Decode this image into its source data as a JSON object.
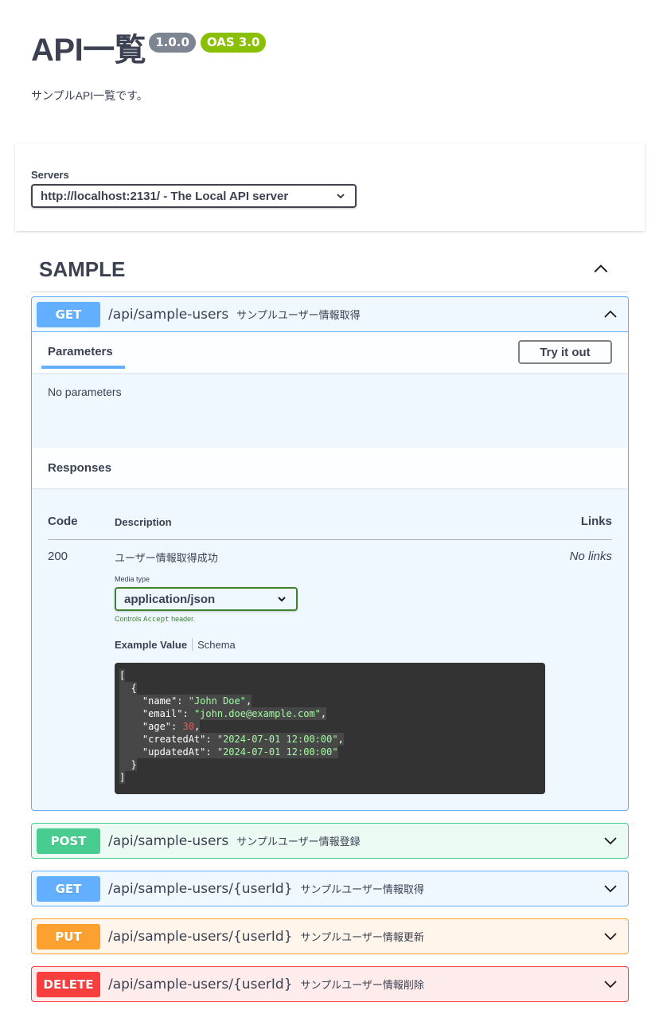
{
  "info": {
    "title": "API一覧",
    "version": "1.0.0",
    "oas": "OAS 3.0",
    "description": "サンプルAPI一覧です。"
  },
  "servers": {
    "label": "Servers",
    "selected": "http://localhost:2131/ - The Local API server"
  },
  "tag": {
    "name": "SAMPLE"
  },
  "operations": [
    {
      "method": "GET",
      "path": "/api/sample-users",
      "summary": "サンプルユーザー情報取得"
    },
    {
      "method": "POST",
      "path": "/api/sample-users",
      "summary": "サンプルユーザー情報登録"
    },
    {
      "method": "GET",
      "path": "/api/sample-users/{userId}",
      "summary": "サンプルユーザー情報取得"
    },
    {
      "method": "PUT",
      "path": "/api/sample-users/{userId}",
      "summary": "サンプルユーザー情報更新"
    },
    {
      "method": "DELETE",
      "path": "/api/sample-users/{userId}",
      "summary": "サンプルユーザー情報削除"
    }
  ],
  "expanded": {
    "parameters_tab": "Parameters",
    "try_button": "Try it out",
    "no_params": "No parameters",
    "responses_title": "Responses",
    "columns": {
      "code": "Code",
      "description": "Description",
      "links": "Links"
    },
    "response": {
      "code": "200",
      "description": "ユーザー情報取得成功",
      "links": "No links",
      "media_type_label": "Media type",
      "media_type": "application/json",
      "controls_prefix": "Controls",
      "controls_code": "Accept",
      "controls_suffix": "header.",
      "example_tab": "Example Value",
      "schema_tab": "Schema",
      "example": {
        "name": "John Doe",
        "email": "john.doe@example.com",
        "age": "30",
        "createdAt": "2024-07-01 12:00:00",
        "updatedAt": "2024-07-01 12:00:00"
      }
    }
  },
  "colors": {
    "get": "#61affe",
    "post": "#49cc90",
    "put": "#fca130",
    "delete": "#f93e3e",
    "version_badge": "#7d8492",
    "oas_badge": "#89bf04"
  }
}
